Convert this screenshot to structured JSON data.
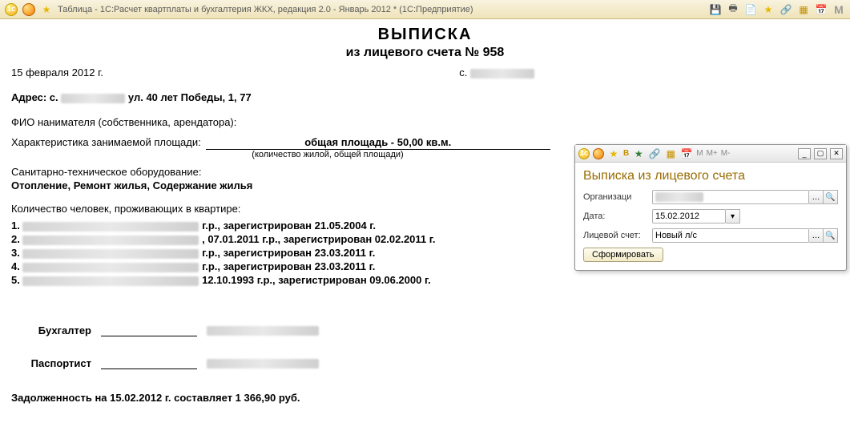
{
  "titlebar": {
    "title": "Таблица - 1С:Расчет квартплаты и бухгалтерия ЖКХ, редакция 2.0 - Январь 2012 *  (1С:Предприятие)"
  },
  "doc": {
    "heading1": "ВЫПИСКА",
    "heading2": "из лицевого счета № 958",
    "date": "15 февраля 2012 г.",
    "c_label": "с.",
    "address_label": "Адрес: с.",
    "address_rest": "ул. 40 лет Победы, 1,  77",
    "fio_label": "ФИО нанимателя (собственника, арендатора):",
    "char_label": "Характеристика занимаемой площади:",
    "char_value": "общая площадь - 50,00 кв.м.",
    "char_note": "(количество жилой, общей площади)",
    "san_label": "Санитарно-техническое оборудование:",
    "equipment": "Отопление, Ремонт жилья, Содержание жилья",
    "residents_label": "Количество человек, проживающих в квартире:",
    "residents": [
      {
        "n": "1.",
        "tail": "г.р., зарегистрирован 21.05.2004 г."
      },
      {
        "n": "2.",
        "mid": ", 07.01.2011 г.р., зарегистрирован 02.02.2011 г."
      },
      {
        "n": "3.",
        "tail": "г.р., зарегистрирован 23.03.2011 г."
      },
      {
        "n": "4.",
        "tail": "г.р., зарегистрирован 23.03.2011 г."
      },
      {
        "n": "5.",
        "mid": "12.10.1993 г.р., зарегистрирован 09.06.2000 г."
      }
    ],
    "sig_accountant": "Бухгалтер",
    "sig_passport": "Паспортист",
    "debt": "Задолженность на 15.02.2012 г. составляет 1 366,90 руб."
  },
  "dialog": {
    "title": "Выписка из лицевого счета",
    "org_label": "Организаци",
    "org_value": "",
    "date_label": "Дата:",
    "date_value": "15.02.2012",
    "acc_label": "Лицевой счет:",
    "acc_value": "Новый л/с",
    "submit": "Сформировать",
    "toolbar": {
      "b": "B",
      "m": "M",
      "mplus": "M+",
      "mminus": "M-"
    }
  }
}
